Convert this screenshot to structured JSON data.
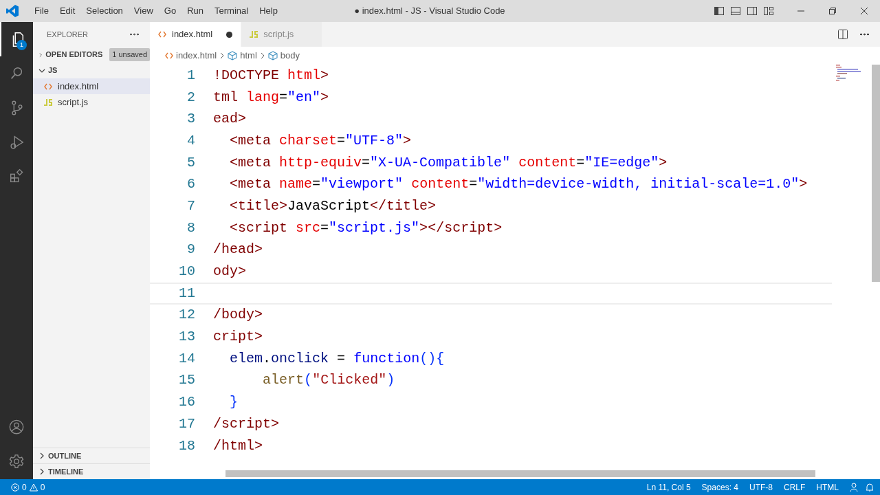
{
  "title_bar": {
    "menu": [
      "File",
      "Edit",
      "Selection",
      "View",
      "Go",
      "Run",
      "Terminal",
      "Help"
    ],
    "title": "● index.html - JS - Visual Studio Code"
  },
  "activity_bar": {
    "items": [
      {
        "selected": true,
        "badge": "1"
      },
      {
        "selected": false
      },
      {
        "selected": false
      },
      {
        "selected": false
      },
      {
        "selected": false
      }
    ]
  },
  "sidebar": {
    "title": "EXPLORER",
    "sections": [
      {
        "label": "OPEN EDITORS",
        "expanded": false,
        "badge": "1 unsaved"
      }
    ],
    "folder": {
      "label": "JS",
      "expanded": true,
      "children": [
        {
          "name": "index.html",
          "kind": "html",
          "selected": true
        },
        {
          "name": "script.js",
          "kind": "js",
          "selected": false
        }
      ]
    },
    "bottom_sections": [
      {
        "label": "OUTLINE",
        "expanded": false
      },
      {
        "label": "TIMELINE",
        "expanded": false
      }
    ]
  },
  "tabs": [
    {
      "label": "index.html",
      "kind": "html",
      "selected": true,
      "modified": true
    },
    {
      "label": "script.js",
      "kind": "js",
      "selected": false,
      "modified": false
    }
  ],
  "breadcrumb": [
    {
      "label": "index.html",
      "kind": "html"
    },
    {
      "label": "html",
      "kind": "element"
    },
    {
      "label": "body",
      "kind": "element"
    }
  ],
  "code": [
    {
      "number": "1",
      "current": false,
      "kind": "html",
      "text": "!DOCTYPE html>"
    },
    {
      "number": "2",
      "current": false,
      "kind": "html",
      "text": "tml lang=\"en\">"
    },
    {
      "number": "3",
      "current": false,
      "kind": "html",
      "text": "ead>"
    },
    {
      "number": "4",
      "current": false,
      "kind": "html",
      "text": "  <meta charset=\"UTF-8\">"
    },
    {
      "number": "5",
      "current": false,
      "kind": "html",
      "text": "  <meta http-equiv=\"X-UA-Compatible\" content=\"IE=edge\">"
    },
    {
      "number": "6",
      "current": false,
      "kind": "html",
      "text": "  <meta name=\"viewport\" content=\"width=device-width, initial-scale=1.0\">"
    },
    {
      "number": "7",
      "current": false,
      "kind": "html",
      "text": "  <title>JavaScript</title>"
    },
    {
      "number": "8",
      "current": false,
      "kind": "html",
      "text": "  <script src=\"script.js\"></script>"
    },
    {
      "number": "9",
      "current": false,
      "kind": "html",
      "text": "/head>"
    },
    {
      "number": "10",
      "current": false,
      "kind": "html",
      "text": "ody>"
    },
    {
      "number": "11",
      "current": true
    },
    {
      "number": "12",
      "current": false,
      "kind": "html",
      "text": "/body>"
    },
    {
      "number": "13",
      "current": false,
      "kind": "html",
      "text": "cript>"
    },
    {
      "number": "14",
      "current": false,
      "kind": "js",
      "text": "  elem.onclick = function(){"
    },
    {
      "number": "15",
      "current": false,
      "kind": "js",
      "text": "      alert(\"Clicked\")"
    },
    {
      "number": "16",
      "current": false,
      "kind": "js",
      "text": "  }"
    },
    {
      "number": "17",
      "current": false,
      "kind": "html",
      "text": "/script>"
    },
    {
      "number": "18",
      "current": false,
      "kind": "html",
      "text": "/html>"
    }
  ],
  "status_bar": {
    "errors": "0",
    "warnings": "0",
    "items": [
      "Ln 11, Col 5",
      "Spaces: 4",
      "UTF-8",
      "CRLF",
      "HTML"
    ]
  }
}
